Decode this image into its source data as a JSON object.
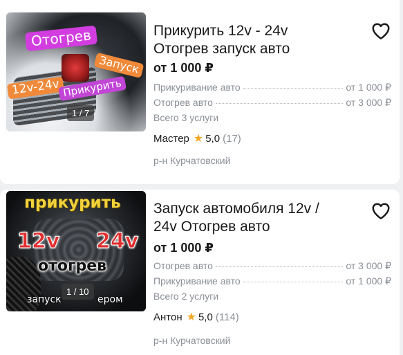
{
  "listings": [
    {
      "title_line1": "Прикурить 12v - 24v",
      "title_line2": "Отогрев запуск авто",
      "price": "от 1 000 ₽",
      "services": [
        {
          "name": "Прикуривание авто",
          "price": "от 1 000 ₽"
        },
        {
          "name": "Отогрев авто",
          "price": "от 3 000 ₽"
        }
      ],
      "services_count": "Всего 3 услуги",
      "master_name": "Мастер",
      "rating": "5,0",
      "reviews": "(17)",
      "district": "р-н Курчатовский",
      "image_counter": "1 / 7",
      "stickers": {
        "a": "Отогрев",
        "b": "Запуск",
        "c": "12v-24v",
        "d": "Прикурить"
      }
    },
    {
      "title_line1": "Запуск автомобиля 12v /",
      "title_line2": "24v Отогрев авто",
      "price": "от 1 000 ₽",
      "services": [
        {
          "name": "Отогрев авто",
          "price": "от 3 000 ₽"
        },
        {
          "name": "Прикуривание авто",
          "price": "от 1 000 ₽"
        }
      ],
      "services_count": "Всего 2 услуги",
      "master_name": "Антон",
      "rating": "5,0",
      "reviews": "(114)",
      "district": "р-н Курчатовский",
      "image_counter": "1 / 10",
      "stickers": {
        "a": "прикурить",
        "b": "12v",
        "c": "24v",
        "d": "отогрев",
        "e": "запуск",
        "f": "ером"
      }
    }
  ],
  "colors": {
    "accent_star": "#f5a623",
    "sticker_pink": "#d23de0",
    "sticker_orange": "#f08a3a",
    "sticker_yellow": "#f2d23a",
    "sticker_red": "#e12f2f"
  },
  "icons": {
    "favorite": "heart-outline-icon",
    "rating": "star-icon"
  }
}
